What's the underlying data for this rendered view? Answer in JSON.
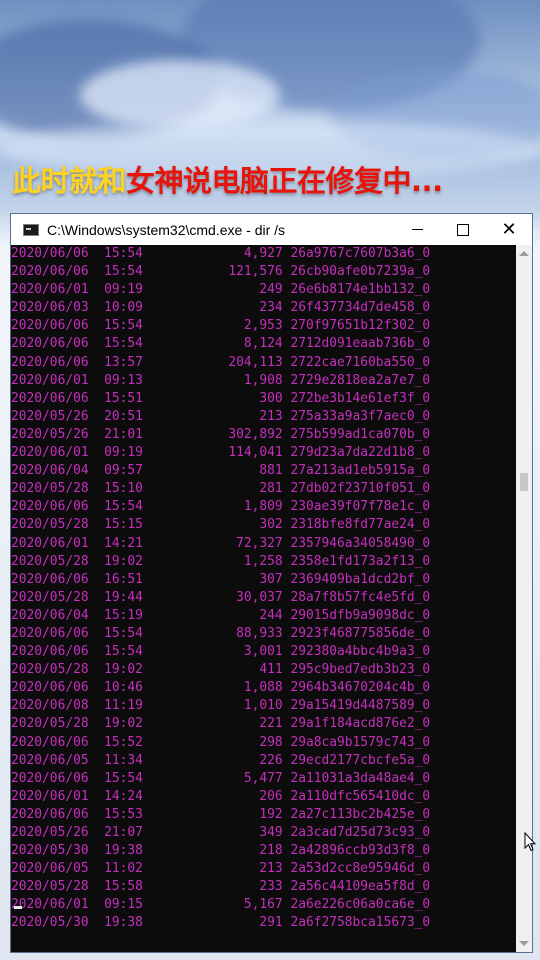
{
  "caption": {
    "part1": "此时就和",
    "part2": "女神说电脑",
    "part3": "正在修复中..."
  },
  "window": {
    "title": "C:\\Windows\\system32\\cmd.exe - dir /s",
    "icon": "cmd-icon",
    "controls": [
      "minimize-icon",
      "maximize-icon",
      "close-icon"
    ]
  },
  "console": {
    "text_color": "#c62fbd",
    "rows": [
      {
        "date": "2020/06/06",
        "time": "15:54",
        "size": "4,927",
        "name": "26a9767c7607b3a6_0"
      },
      {
        "date": "2020/06/06",
        "time": "15:54",
        "size": "121,576",
        "name": "26cb90afe0b7239a_0"
      },
      {
        "date": "2020/06/01",
        "time": "09:19",
        "size": "249",
        "name": "26e6b8174e1bb132_0"
      },
      {
        "date": "2020/06/03",
        "time": "10:09",
        "size": "234",
        "name": "26f437734d7de458_0"
      },
      {
        "date": "2020/06/06",
        "time": "15:54",
        "size": "2,953",
        "name": "270f97651b12f302_0"
      },
      {
        "date": "2020/06/06",
        "time": "15:54",
        "size": "8,124",
        "name": "2712d091eaab736b_0"
      },
      {
        "date": "2020/06/06",
        "time": "13:57",
        "size": "204,113",
        "name": "2722cae7160ba550_0"
      },
      {
        "date": "2020/06/01",
        "time": "09:13",
        "size": "1,908",
        "name": "2729e2818ea2a7e7_0"
      },
      {
        "date": "2020/06/06",
        "time": "15:51",
        "size": "300",
        "name": "272be3b14e61ef3f_0"
      },
      {
        "date": "2020/05/26",
        "time": "20:51",
        "size": "213",
        "name": "275a33a9a3f7aec0_0"
      },
      {
        "date": "2020/05/26",
        "time": "21:01",
        "size": "302,892",
        "name": "275b599ad1ca070b_0"
      },
      {
        "date": "2020/06/01",
        "time": "09:19",
        "size": "114,041",
        "name": "279d23a7da22d1b8_0"
      },
      {
        "date": "2020/06/04",
        "time": "09:57",
        "size": "881",
        "name": "27a213ad1eb5915a_0"
      },
      {
        "date": "2020/05/28",
        "time": "15:10",
        "size": "281",
        "name": "27db02f23710f051_0"
      },
      {
        "date": "2020/06/06",
        "time": "15:54",
        "size": "1,809",
        "name": "230ae39f07f78e1c_0"
      },
      {
        "date": "2020/05/28",
        "time": "15:15",
        "size": "302",
        "name": "2318bfe8fd77ae24_0"
      },
      {
        "date": "2020/06/01",
        "time": "14:21",
        "size": "72,327",
        "name": "2357946a34058490_0"
      },
      {
        "date": "2020/05/28",
        "time": "19:02",
        "size": "1,258",
        "name": "2358e1fd173a2f13_0"
      },
      {
        "date": "2020/06/06",
        "time": "16:51",
        "size": "307",
        "name": "2369409ba1dcd2bf_0"
      },
      {
        "date": "2020/05/28",
        "time": "19:44",
        "size": "30,037",
        "name": "28a7f8b57fc4e5fd_0"
      },
      {
        "date": "2020/06/04",
        "time": "15:19",
        "size": "244",
        "name": "29015dfb9a9098dc_0"
      },
      {
        "date": "2020/06/06",
        "time": "15:54",
        "size": "88,933",
        "name": "2923f468775856de_0"
      },
      {
        "date": "2020/06/06",
        "time": "15:54",
        "size": "3,001",
        "name": "292380a4bbc4b9a3_0"
      },
      {
        "date": "2020/05/28",
        "time": "19:02",
        "size": "411",
        "name": "295c9bed7edb3b23_0"
      },
      {
        "date": "2020/06/06",
        "time": "10:46",
        "size": "1,088",
        "name": "2964b34670204c4b_0"
      },
      {
        "date": "2020/06/08",
        "time": "11:19",
        "size": "1,010",
        "name": "29a15419d4487589_0"
      },
      {
        "date": "2020/05/28",
        "time": "19:02",
        "size": "221",
        "name": "29a1f184acd876e2_0"
      },
      {
        "date": "2020/06/06",
        "time": "15:52",
        "size": "298",
        "name": "29a8ca9b1579c743_0"
      },
      {
        "date": "2020/06/05",
        "time": "11:34",
        "size": "226",
        "name": "29ecd2177cbcfe5a_0"
      },
      {
        "date": "2020/06/06",
        "time": "15:54",
        "size": "5,477",
        "name": "2a11031a3da48ae4_0"
      },
      {
        "date": "2020/06/01",
        "time": "14:24",
        "size": "206",
        "name": "2a110dfc565410dc_0"
      },
      {
        "date": "2020/06/06",
        "time": "15:53",
        "size": "192",
        "name": "2a27c113bc2b425e_0"
      },
      {
        "date": "2020/05/26",
        "time": "21:07",
        "size": "349",
        "name": "2a3cad7d25d73c93_0"
      },
      {
        "date": "2020/05/30",
        "time": "19:38",
        "size": "218",
        "name": "2a42896ccb93d3f8_0"
      },
      {
        "date": "2020/06/05",
        "time": "11:02",
        "size": "213",
        "name": "2a53d2cc8e95946d_0"
      },
      {
        "date": "2020/05/28",
        "time": "15:58",
        "size": "233",
        "name": "2a56c44109ea5f8d_0"
      },
      {
        "date": "2020/06/01",
        "time": "09:15",
        "size": "5,167",
        "name": "2a6e226c06a0ca6e_0"
      },
      {
        "date": "2020/05/30",
        "time": "19:38",
        "size": "291",
        "name": "2a6f2758bca15673_0"
      }
    ]
  }
}
